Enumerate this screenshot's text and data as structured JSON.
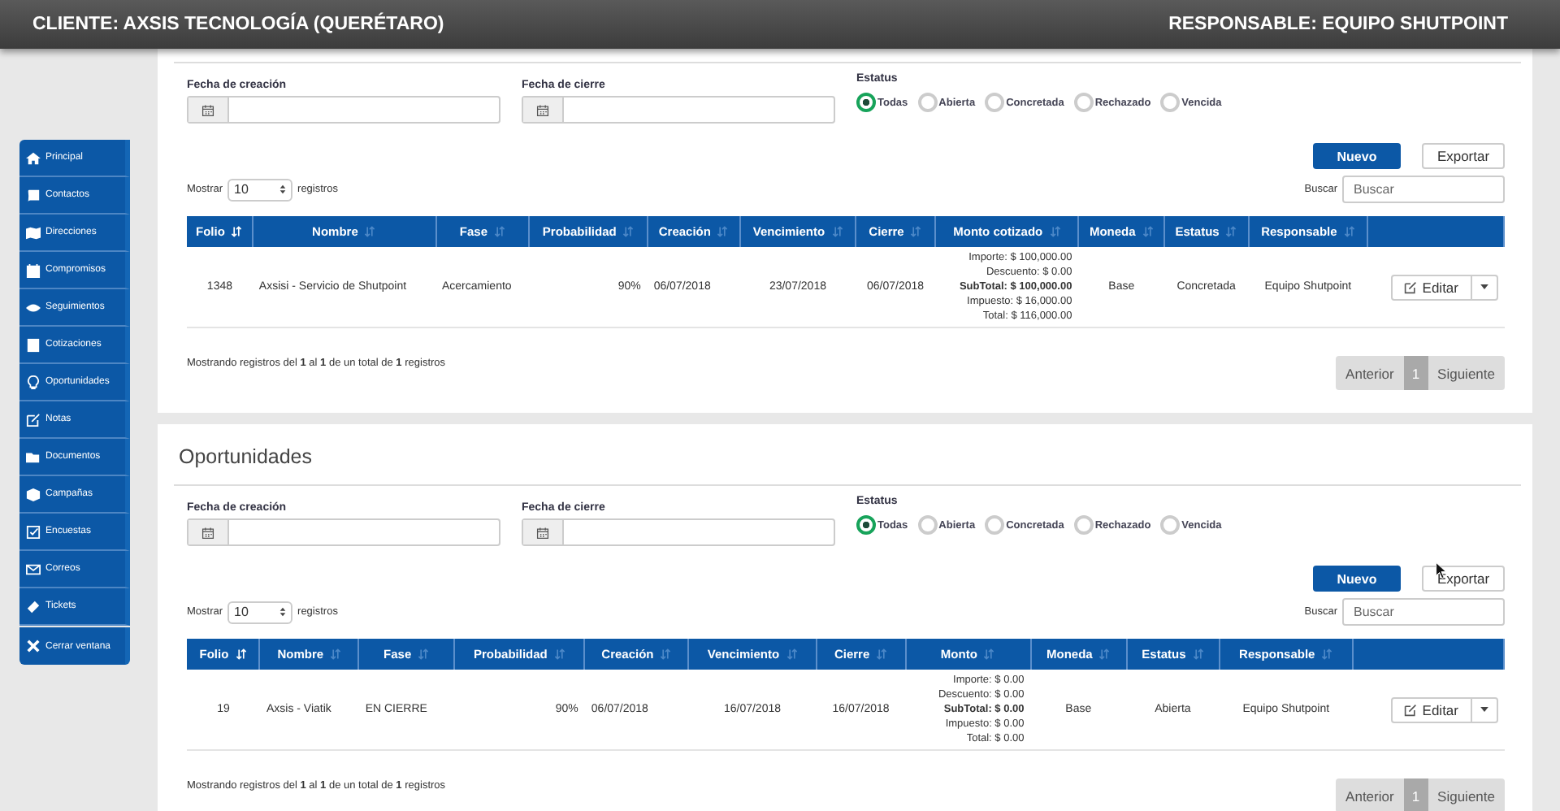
{
  "header": {
    "client": "CLIENTE: AXSIS TECNOLOGÍA (QUERÉTARO)",
    "responsible": "RESPONSABLE: EQUIPO SHUTPOINT"
  },
  "sidebar": {
    "items": [
      {
        "label": "Principal"
      },
      {
        "label": "Contactos"
      },
      {
        "label": "Direcciones"
      },
      {
        "label": "Compromisos"
      },
      {
        "label": "Seguimientos"
      },
      {
        "label": "Cotizaciones"
      },
      {
        "label": "Oportunidades"
      },
      {
        "label": "Notas"
      },
      {
        "label": "Documentos"
      },
      {
        "label": "Campañas"
      },
      {
        "label": "Encuestas"
      },
      {
        "label": "Correos"
      },
      {
        "label": "Tickets"
      },
      {
        "label": "Cerrar ventana"
      }
    ]
  },
  "panels": [
    {
      "creation_label": "Fecha de creación",
      "close_label": "Fecha de cierre",
      "status_label": "Estatus",
      "statuses": [
        {
          "label": "Todas",
          "selected": true
        },
        {
          "label": "Abierta",
          "selected": false
        },
        {
          "label": "Concretada",
          "selected": false
        },
        {
          "label": "Rechazado",
          "selected": false
        },
        {
          "label": "Vencida",
          "selected": false
        }
      ],
      "new_button": "Nuevo",
      "export_button": "Exportar",
      "show_label": "Mostrar",
      "show_value": "10",
      "records_label": "registros",
      "search_label": "Buscar",
      "search_placeholder": "Buscar",
      "columns": [
        {
          "label": "Folio",
          "sorted": true
        },
        {
          "label": "Nombre",
          "sorted": false
        },
        {
          "label": "Fase",
          "sorted": false
        },
        {
          "label": "Probabilidad",
          "sorted": false
        },
        {
          "label": "Creación",
          "sorted": false
        },
        {
          "label": "Vencimiento",
          "sorted": false
        },
        {
          "label": "Cierre",
          "sorted": false
        },
        {
          "label": "Monto cotizado",
          "sorted": false
        },
        {
          "label": "Moneda",
          "sorted": false
        },
        {
          "label": "Estatus",
          "sorted": false
        },
        {
          "label": "Responsable",
          "sorted": false
        }
      ],
      "rows": [
        {
          "folio": "1348",
          "name": "Axsisi - Servicio de Shutpoint",
          "phase": "Acercamiento",
          "probability": "90%",
          "created": "06/07/2018",
          "due": "23/07/2018",
          "closed": "06/07/2018",
          "amounts": [
            {
              "text": "Importe: $ 100,000.00",
              "bold": false
            },
            {
              "text": "Descuento: $ 0.00",
              "bold": false
            },
            {
              "text": "SubTotal: $ 100,000.00",
              "bold": true
            },
            {
              "text": "Impuesto: $ 16,000.00",
              "bold": false
            },
            {
              "text": "Total: $ 116,000.00",
              "bold": false
            }
          ],
          "currency": "Base",
          "status": "Concretada",
          "responsible": "Equipo Shutpoint",
          "edit_button": "Editar"
        }
      ],
      "info": "Mostrando registros del **1** al **1** de un total de **1** registros",
      "pager": {
        "previous": "Anterior",
        "page": "1",
        "next": "Siguiente"
      }
    },
    {
      "title": "Oportunidades",
      "creation_label": "Fecha de creación",
      "close_label": "Fecha de cierre",
      "status_label": "Estatus",
      "statuses": [
        {
          "label": "Todas",
          "selected": true
        },
        {
          "label": "Abierta",
          "selected": false
        },
        {
          "label": "Concretada",
          "selected": false
        },
        {
          "label": "Rechazado",
          "selected": false
        },
        {
          "label": "Vencida",
          "selected": false
        }
      ],
      "new_button": "Nuevo",
      "export_button": "Exportar",
      "show_label": "Mostrar",
      "show_value": "10",
      "records_label": "registros",
      "search_label": "Buscar",
      "search_placeholder": "Buscar",
      "columns": [
        {
          "label": "Folio",
          "sorted": true
        },
        {
          "label": "Nombre",
          "sorted": false
        },
        {
          "label": "Fase",
          "sorted": false
        },
        {
          "label": "Probabilidad",
          "sorted": false
        },
        {
          "label": "Creación",
          "sorted": false
        },
        {
          "label": "Vencimiento",
          "sorted": false
        },
        {
          "label": "Cierre",
          "sorted": false
        },
        {
          "label": "Monto",
          "sorted": false
        },
        {
          "label": "Moneda",
          "sorted": false
        },
        {
          "label": "Estatus",
          "sorted": false
        },
        {
          "label": "Responsable",
          "sorted": false
        }
      ],
      "rows": [
        {
          "folio": "19",
          "name": "Axsis - Viatik",
          "phase": "EN CIERRE",
          "probability": "90%",
          "created": "06/07/2018",
          "due": "16/07/2018",
          "closed": "16/07/2018",
          "amounts": [
            {
              "text": "Importe: $ 0.00",
              "bold": false
            },
            {
              "text": "Descuento: $ 0.00",
              "bold": false
            },
            {
              "text": "SubTotal: $ 0.00",
              "bold": true
            },
            {
              "text": "Impuesto: $ 0.00",
              "bold": false
            },
            {
              "text": "Total: $ 0.00",
              "bold": false
            }
          ],
          "currency": "Base",
          "status": "Abierta",
          "responsible": "Equipo Shutpoint",
          "edit_button": "Editar"
        }
      ],
      "info": "Mostrando registros del **1** al **1** de un total de **1** registros",
      "pager": {
        "previous": "Anterior",
        "page": "1",
        "next": "Siguiente"
      }
    }
  ]
}
